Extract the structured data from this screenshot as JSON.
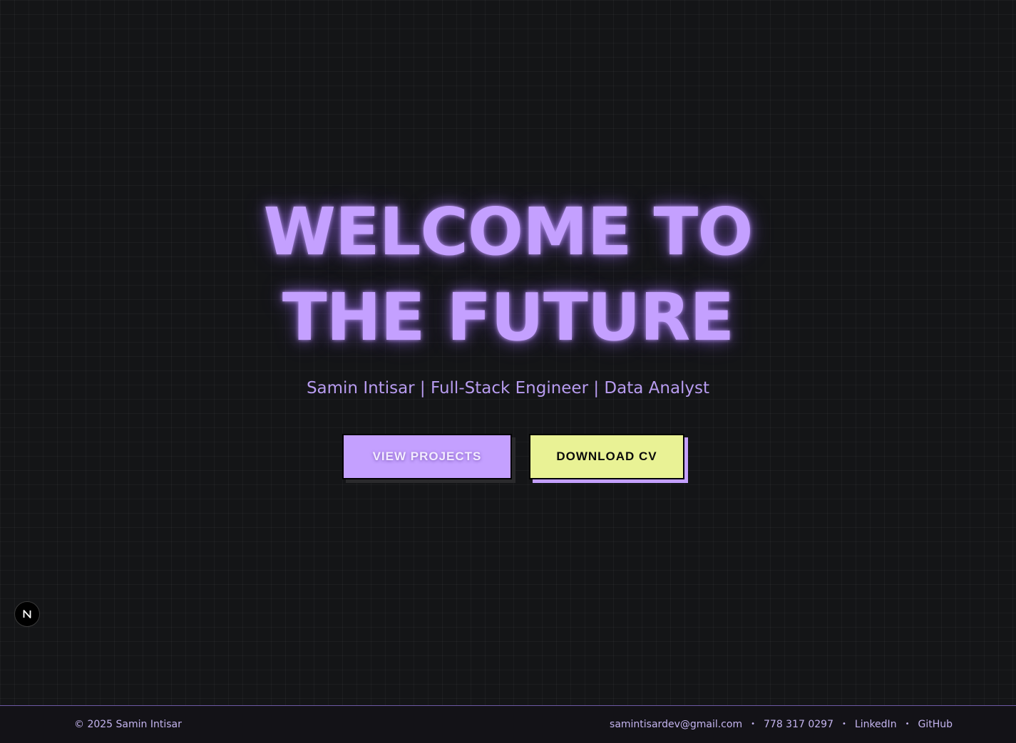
{
  "hero": {
    "title_line1": "WELCOME TO",
    "title_line2": "THE FUTURE",
    "subtitle": "Samin Intisar | Full-Stack Engineer | Data Analyst"
  },
  "buttons": {
    "view_projects": "VIEW PROJECTS",
    "download_cv": "DOWNLOAD CV"
  },
  "badge": {
    "letter": "N",
    "icon": "nextjs-logo-icon"
  },
  "footer": {
    "copyright": "© 2025 Samin Intisar",
    "email": "samintisardev@gmail.com",
    "phone": "778 317 0297",
    "linkedin": "LinkedIn",
    "github": "GitHub",
    "separator": "•"
  },
  "colors": {
    "background": "#141517",
    "accent_purple": "#c4a0ff",
    "accent_yellow": "#e9f295",
    "footer_bg": "#131217",
    "footer_text": "#c4b4ef"
  }
}
